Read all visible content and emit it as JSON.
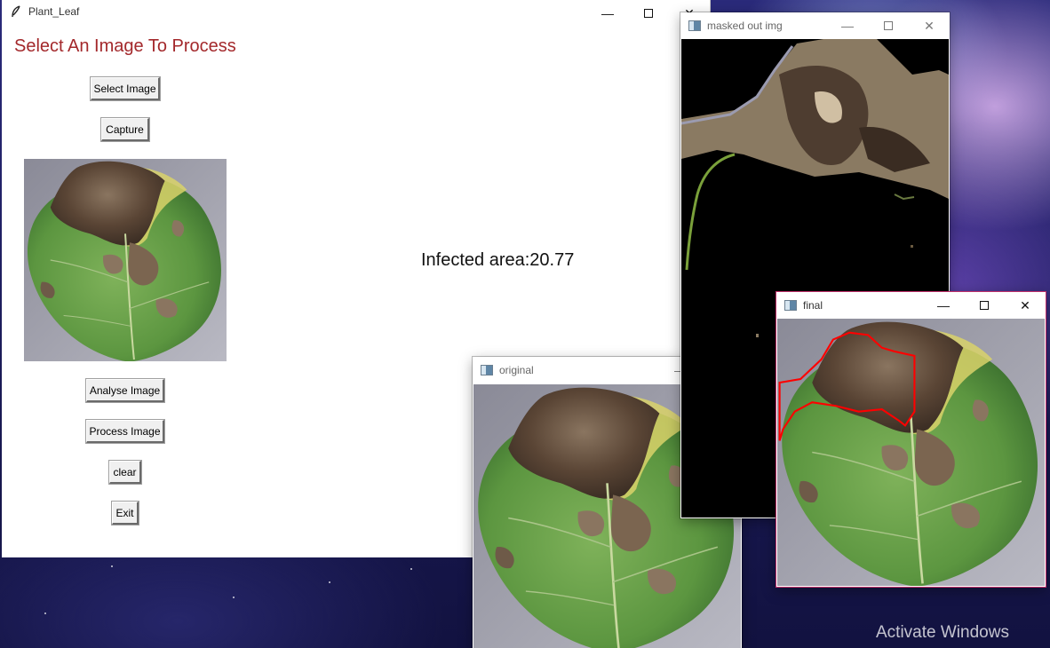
{
  "main_window": {
    "title": "Plant_Leaf",
    "heading": "Select An Image To Process",
    "buttons": {
      "select_image": "Select Image",
      "capture": "Capture",
      "analyse_image": "Analyse Image",
      "process_image": "Process Image",
      "clear": "clear",
      "exit": "Exit"
    },
    "result_text": "Infected area:20.77"
  },
  "windows": {
    "masked": {
      "title": "masked out img"
    },
    "original": {
      "title": "original"
    },
    "final": {
      "title": "final"
    }
  },
  "desktop": {
    "watermark": "Activate Windows"
  },
  "colors": {
    "heading": "#a3282b",
    "infection_contour": "#ff0000"
  },
  "icons": {
    "app_icon": "feather-icon",
    "window_icon": "image-window-icon",
    "minimize": "minimize-icon",
    "maximize": "maximize-icon",
    "close": "close-icon"
  }
}
